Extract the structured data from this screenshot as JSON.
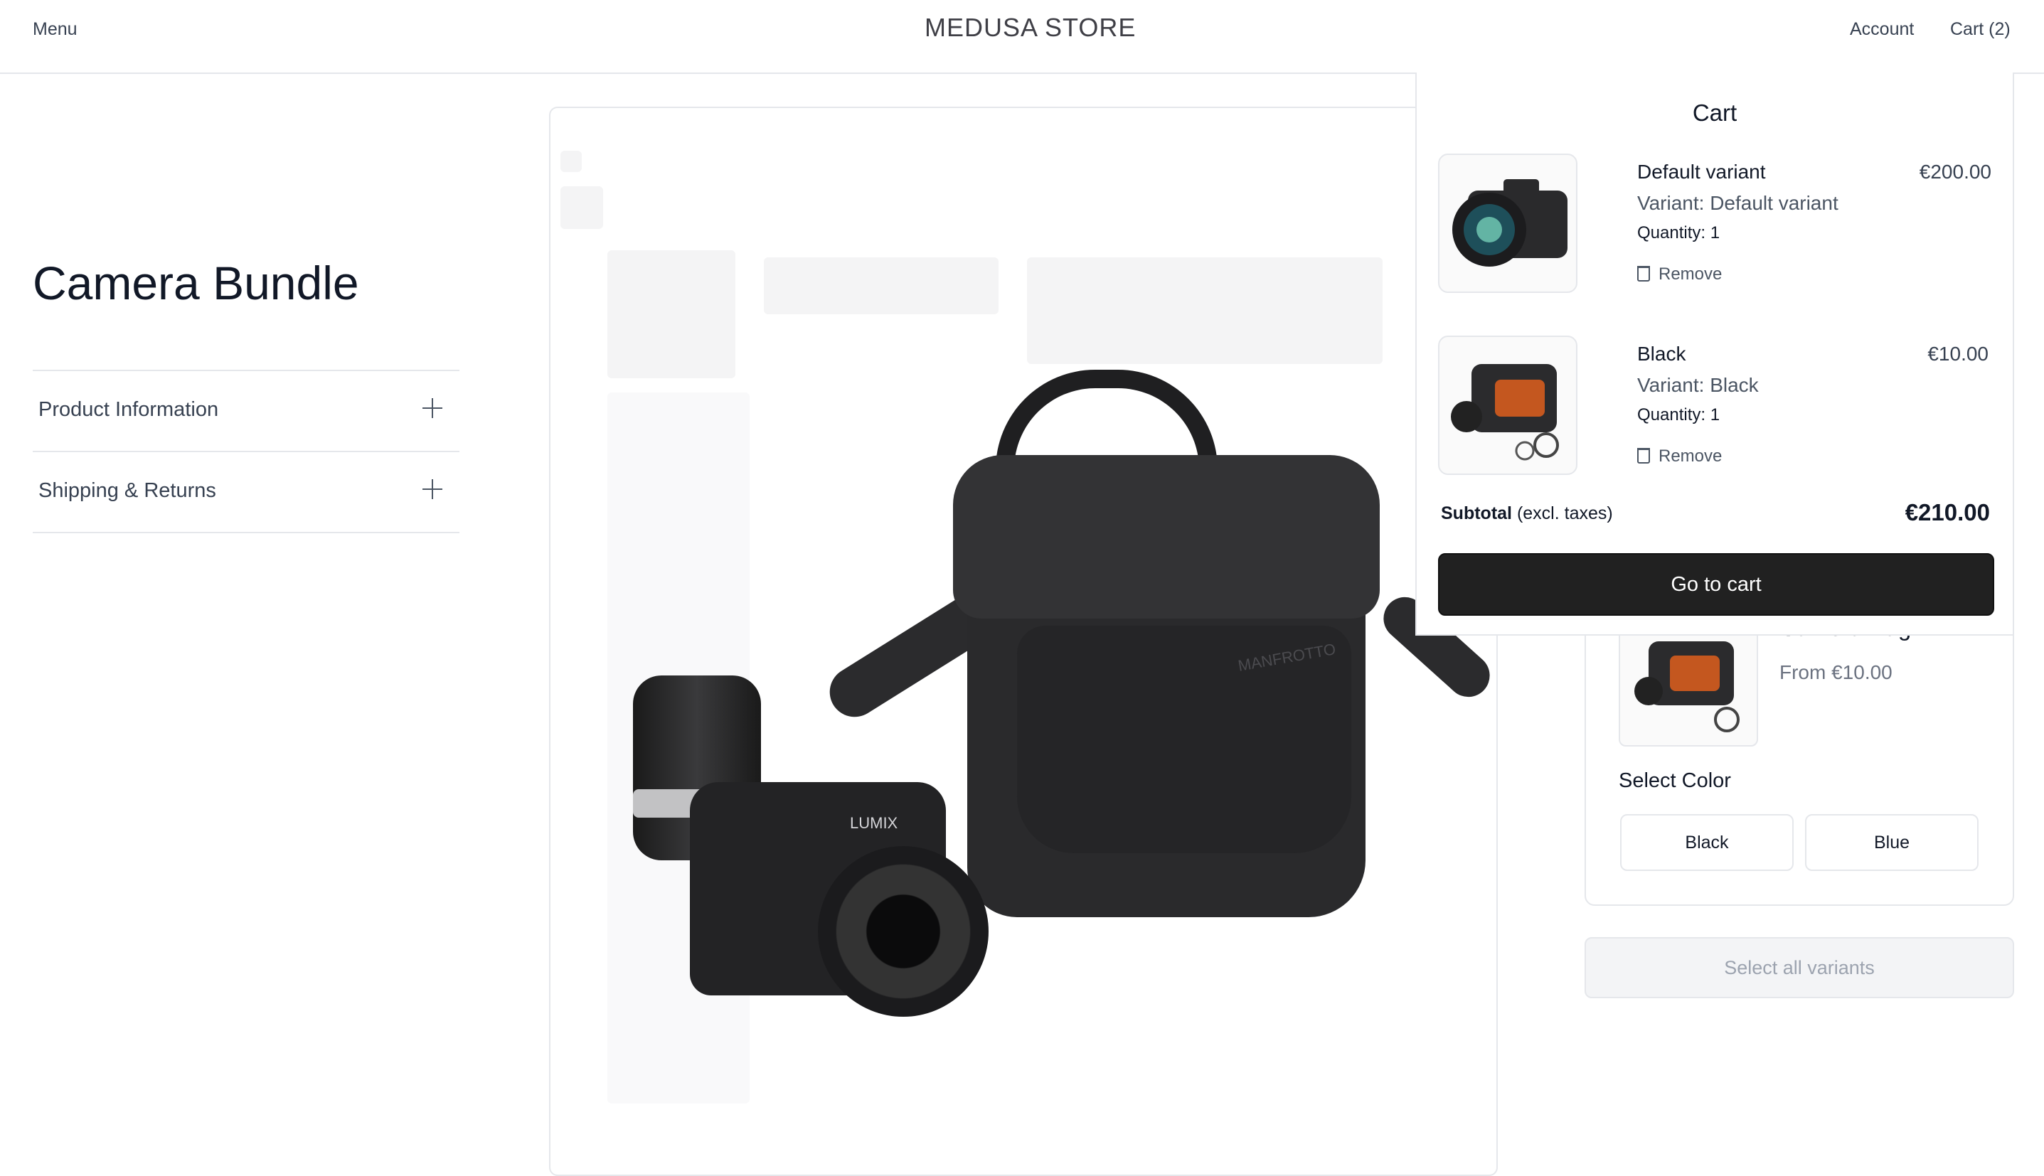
{
  "header": {
    "menu_label": "Menu",
    "brand": "MEDUSA STORE",
    "account_label": "Account",
    "cart_label": "Cart (2)"
  },
  "product": {
    "title": "Camera Bundle",
    "accordions": [
      {
        "label": "Product Information"
      },
      {
        "label": "Shipping & Returns"
      }
    ],
    "image_logo_text": "MANFROTTO",
    "image_camera_text": "LUMIX"
  },
  "cart": {
    "title": "Cart",
    "items": [
      {
        "name": "Default variant",
        "variant": "Variant: Default variant",
        "quantity": "Quantity: 1",
        "remove_label": "Remove",
        "price": "€200.00",
        "icon": "camera-thumbnail"
      },
      {
        "name": "Black",
        "variant": "Variant: Black",
        "quantity": "Quantity: 1",
        "remove_label": "Remove",
        "price": "€10.00",
        "icon": "camera-bag-thumbnail"
      }
    ],
    "subtotal_label": "Subtotal",
    "subtotal_note": "(excl. taxes)",
    "subtotal_value": "€210.00",
    "go_to_cart_label": "Go to cart"
  },
  "bundle_item": {
    "name": "Camera Bag",
    "price_from": "From €10.00",
    "select_color_label": "Select Color",
    "color_options": [
      "Black",
      "Blue"
    ],
    "select_all_label": "Select all variants"
  },
  "colors": {
    "primary_button": "#212121",
    "border": "#e5e7eb",
    "disabled_button": "#f3f4f6"
  }
}
